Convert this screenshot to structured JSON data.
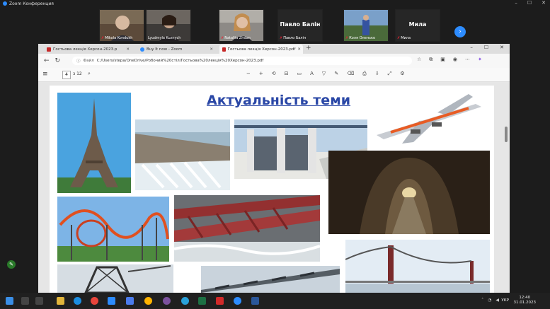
{
  "zoom": {
    "title": "Zoom Конференция",
    "participants": [
      {
        "name": "Mikola Kondukh",
        "muted": true,
        "kind": "video"
      },
      {
        "name": "Lyudmyla Kuznych",
        "muted": false,
        "kind": "video"
      },
      {
        "name": "Nataliia Zhdan",
        "muted": true,
        "kind": "video"
      },
      {
        "big": "Павло Балін",
        "name": "Павло Балін",
        "muted": true,
        "kind": "name"
      },
      {
        "name": "Коля Оленько",
        "muted": true,
        "kind": "video"
      },
      {
        "big": "Мила",
        "name": "Мила",
        "muted": true,
        "kind": "name"
      }
    ],
    "next_icon": "chevron-right-icon",
    "window_controls": [
      "–",
      "☐",
      "✕"
    ]
  },
  "browser": {
    "tabs": [
      {
        "label": "Гостьова лекція Херсон-2023.p",
        "active": false,
        "icon_color": "#c62828"
      },
      {
        "label": "Buy It now - Zoom",
        "active": false,
        "icon_color": "#2d8cff"
      },
      {
        "label": "Гостьова лекція Херсон-2023.pdf",
        "active": true,
        "icon_color": "#c62828"
      }
    ],
    "tab_close": "✕",
    "new_tab": "+",
    "window_controls": [
      "–",
      "☐",
      "✕"
    ],
    "address": {
      "prefix": "Файл",
      "url": "C:/Users/stepa/OneDrive/Робочий%20стіл/Гостьова%20лекція%20Херсон-2023.pdf"
    },
    "pdf": {
      "page": "4",
      "page_count": "з 12"
    }
  },
  "slide": {
    "title": "Актуальність теми"
  },
  "taskbar": {
    "lang": "УКР",
    "time": "12:40",
    "date": "31.01.2023"
  },
  "colors": {
    "zoom_blue": "#2d8cff",
    "title_blue": "#2a47a6",
    "taskbar": "#202020"
  }
}
